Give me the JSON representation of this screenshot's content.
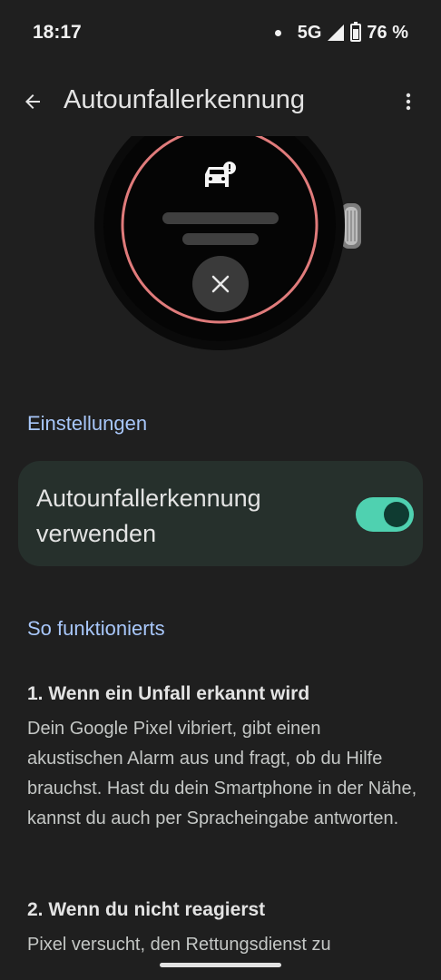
{
  "status": {
    "time": "18:17",
    "network": "5G",
    "battery": "76 %",
    "battery_level": 0.76
  },
  "app_bar": {
    "title": "Autounfallerkennung",
    "back_icon": "arrow-back-icon",
    "menu_icon": "more-vert-icon"
  },
  "settings": {
    "header": "Einstellungen",
    "toggle_label": "Autounfallerkennung verwenden",
    "toggle_on": true
  },
  "how_it_works": {
    "header": "So funktionierts",
    "steps": [
      {
        "title": "1. Wenn ein Unfall erkannt wird",
        "body": "Dein Google Pixel vibriert, gibt einen akustischen Alarm aus und fragt, ob du Hilfe brauchst. Hast du dein Smartphone in der Nähe, kannst du auch per Spracheingabe antworten."
      },
      {
        "title": "2. Wenn du nicht reagierst",
        "body": "Pixel versucht, den Rettungsdienst zu"
      }
    ]
  },
  "colors": {
    "background": "#1f1f1f",
    "accent": "#a8c7fa",
    "switch": "#4fd1b0",
    "card": "#26302c",
    "watch_ring": "#e07b7b"
  }
}
